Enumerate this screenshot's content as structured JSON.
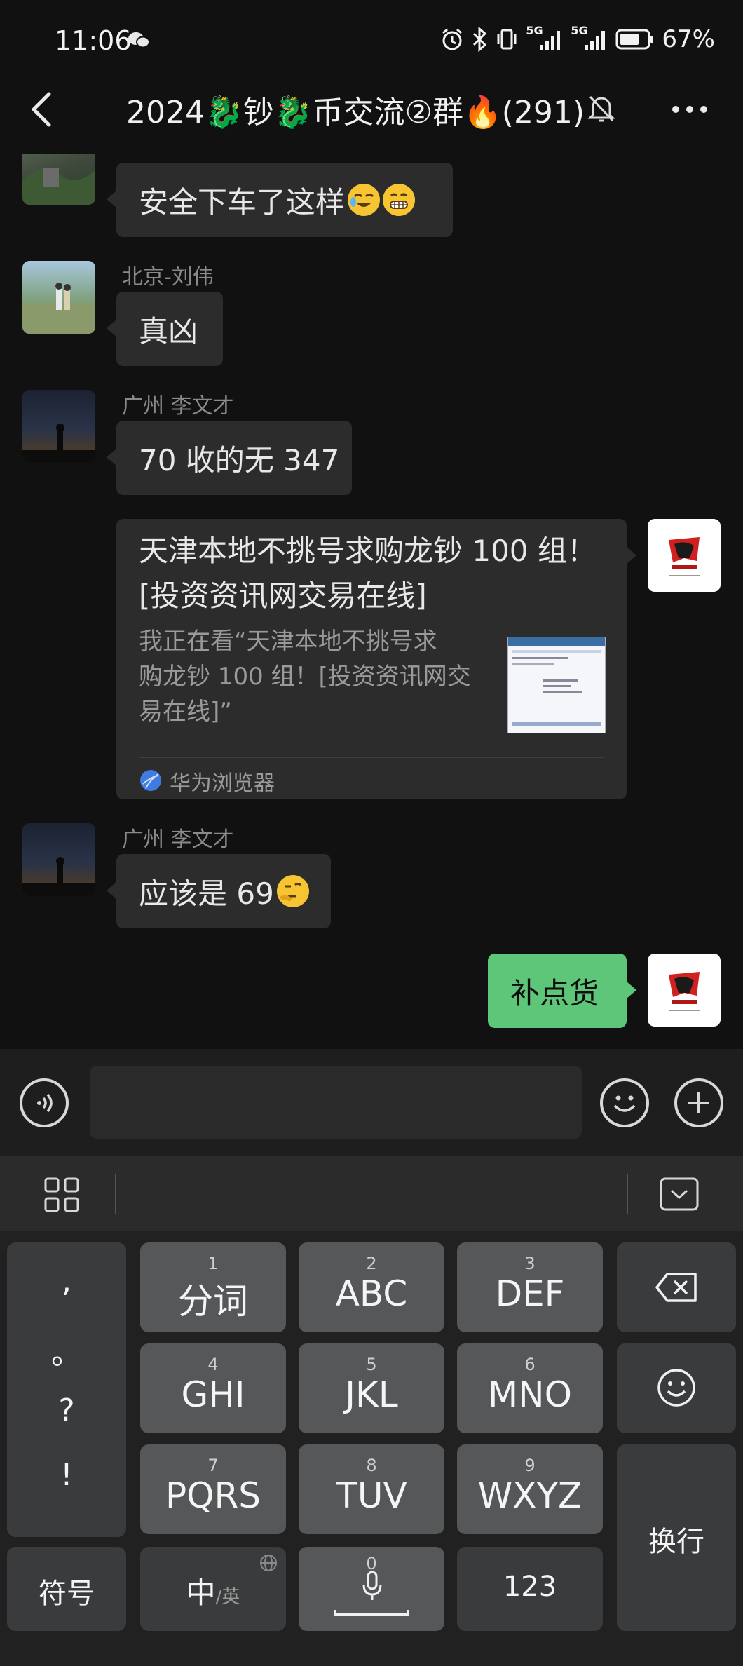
{
  "status_bar": {
    "time": "11:06",
    "signal1_label": "5G",
    "signal2_label": "5G",
    "battery": "67%"
  },
  "header": {
    "title": "2024🐉钞🐉币交流②群🔥(291)"
  },
  "messages": [
    {
      "sender": "",
      "text": "安全下车了这样"
    },
    {
      "sender": "北京-刘伟",
      "text": "真凶"
    },
    {
      "sender": "广州 李文才",
      "text": "70 收的无 347"
    },
    {
      "sender": "",
      "card_title_line1": "天津本地不挑号求购龙钞 100 组！",
      "card_title_line2": "[投资资讯网交易在线]",
      "card_desc_line1": "我正在看“天津本地不挑号求",
      "card_desc_line2": "购龙钞 100 组！[投资资讯网交",
      "card_desc_line3": "易在线]”",
      "card_source": "华为浏览器"
    },
    {
      "sender": "广州 李文才",
      "text": "应该是 69"
    },
    {
      "sender": "",
      "text": "补点货"
    }
  ],
  "input": {
    "placeholder": ""
  },
  "keyboard": {
    "punct": [
      ",",
      "。",
      "?",
      "!"
    ],
    "keys": [
      {
        "num": "1",
        "label": "分词"
      },
      {
        "num": "2",
        "label": "ABC"
      },
      {
        "num": "3",
        "label": "DEF"
      },
      {
        "num": "4",
        "label": "GHI"
      },
      {
        "num": "5",
        "label": "JKL"
      },
      {
        "num": "6",
        "label": "MNO"
      },
      {
        "num": "7",
        "label": "PQRS"
      },
      {
        "num": "8",
        "label": "TUV"
      },
      {
        "num": "9",
        "label": "WXYZ"
      }
    ],
    "symbols": "符号",
    "zh": "中",
    "en": "/英",
    "space_num": "0",
    "num123": "123",
    "enter": "换行"
  },
  "colors": {
    "background": "#111111",
    "bubble": "#2c2c2c",
    "self_bubble": "#5ec679",
    "key": "#555759"
  }
}
